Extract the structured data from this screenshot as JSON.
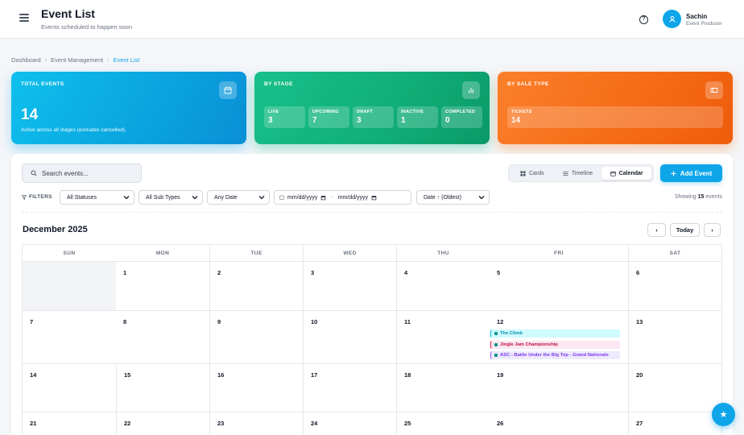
{
  "header": {
    "title": "Event List",
    "subtitle": "Events scheduled to happen soon",
    "help_glyph": "?",
    "user": {
      "name": "Sachin",
      "role": "Event Producer"
    }
  },
  "breadcrumb": [
    "Dashboard",
    "Event Management",
    "Event List"
  ],
  "stats": {
    "total": {
      "label": "TOTAL EVENTS",
      "value": "14",
      "desc": "Active across all stages (excludes cancelled).",
      "icon": "calendar-icon"
    },
    "stage": {
      "label": "BY STAGE",
      "icon": "bar-chart-icon",
      "items": [
        {
          "label": "LIVE",
          "value": "3"
        },
        {
          "label": "UPCOMING",
          "value": "7"
        },
        {
          "label": "DRAFT",
          "value": "3"
        },
        {
          "label": "INACTIVE",
          "value": "1"
        },
        {
          "label": "COMPLETED",
          "value": "0"
        }
      ]
    },
    "sale": {
      "label": "BY SALE TYPE",
      "icon": "ticket-icon",
      "items": [
        {
          "label": "TICKETS",
          "value": "14"
        }
      ]
    }
  },
  "toolbar": {
    "search_placeholder": "Search events...",
    "views": [
      {
        "label": "Cards",
        "icon": "grid-icon",
        "active": false
      },
      {
        "label": "Timeline",
        "icon": "list-icon",
        "active": false
      },
      {
        "label": "Calendar",
        "icon": "calendar-icon",
        "active": true
      }
    ],
    "add_label": "Add Event"
  },
  "filters": {
    "label": "FILTERS",
    "status": "All Statuses",
    "sub_type": "All Sub Types",
    "date": "Any Date",
    "date_from": "mm/dd/yyyy",
    "date_sep": "-",
    "date_to": "mm/dd/yyyy",
    "sort": "Date ↑ (Oldest)",
    "showing_prefix": "Showing",
    "showing_count": "15",
    "showing_suffix": "events"
  },
  "calendar": {
    "month": "December 2025",
    "prev_glyph": "‹",
    "next_glyph": "›",
    "today_label": "Today",
    "days": [
      "SUN",
      "MON",
      "TUE",
      "WED",
      "THU",
      "FRI",
      "SAT"
    ],
    "weeks": [
      [
        "",
        "1",
        "2",
        "3",
        "4",
        "5",
        "6"
      ],
      [
        "7",
        "8",
        "9",
        "10",
        "11",
        "12",
        "13"
      ],
      [
        "14",
        "15",
        "16",
        "17",
        "18",
        "19",
        "20"
      ],
      [
        "21",
        "22",
        "23",
        "24",
        "25",
        "26",
        "27"
      ]
    ],
    "events_dec12": [
      {
        "title": "The Climb",
        "color": "#06b6d4"
      },
      {
        "title": "Jingle Jam Championship",
        "color": "#e11d48"
      },
      {
        "title": "ASC - Battle Under the Big Top - Grand Nationals",
        "color": "#8b5cf6"
      }
    ]
  },
  "fab_icon": "star-icon",
  "fab_glyph": "★",
  "colors": {
    "accent": "#0ea5e9",
    "stage": "#10b981",
    "sale": "#f97316"
  }
}
